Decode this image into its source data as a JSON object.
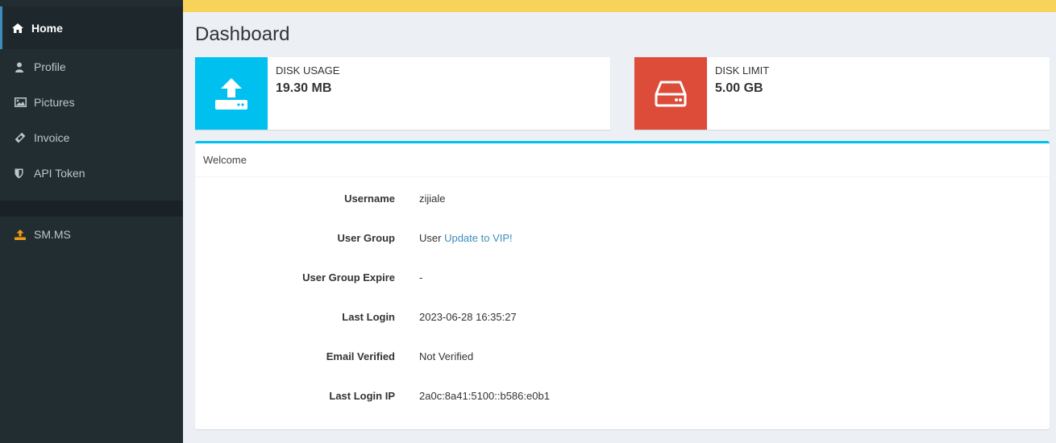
{
  "sidebar": {
    "items": [
      {
        "label": "Home",
        "icon": "home-icon"
      },
      {
        "label": "Profile",
        "icon": "user-icon"
      },
      {
        "label": "Pictures",
        "icon": "image-icon"
      },
      {
        "label": "Invoice",
        "icon": "ticket-icon"
      },
      {
        "label": "API Token",
        "icon": "shield-icon"
      }
    ],
    "smms": {
      "label": "SM.MS",
      "icon": "upload-icon",
      "color": "#f39c12"
    }
  },
  "banner": {
    "color": "#f7d35a"
  },
  "page": {
    "title": "Dashboard"
  },
  "stats": [
    {
      "label": "DISK USAGE",
      "value": "19.30 MB",
      "color": "#00c0ef",
      "icon": "upload-icon"
    },
    {
      "label": "DISK LIMIT",
      "value": "5.00 GB",
      "color": "#dd4b39",
      "icon": "hdd-icon"
    }
  ],
  "welcome": {
    "title": "Welcome",
    "rows": [
      {
        "key": "Username",
        "value": "zijiale"
      },
      {
        "key": "User Group",
        "value": "User",
        "link": "Update to VIP!"
      },
      {
        "key": "User Group Expire",
        "value": "-"
      },
      {
        "key": "Last Login",
        "value": "2023-06-28 16:35:27"
      },
      {
        "key": "Email Verified",
        "value": "Not Verified"
      },
      {
        "key": "Last Login IP",
        "value": "2a0c:8a41:5100::b586:e0b1"
      }
    ]
  }
}
